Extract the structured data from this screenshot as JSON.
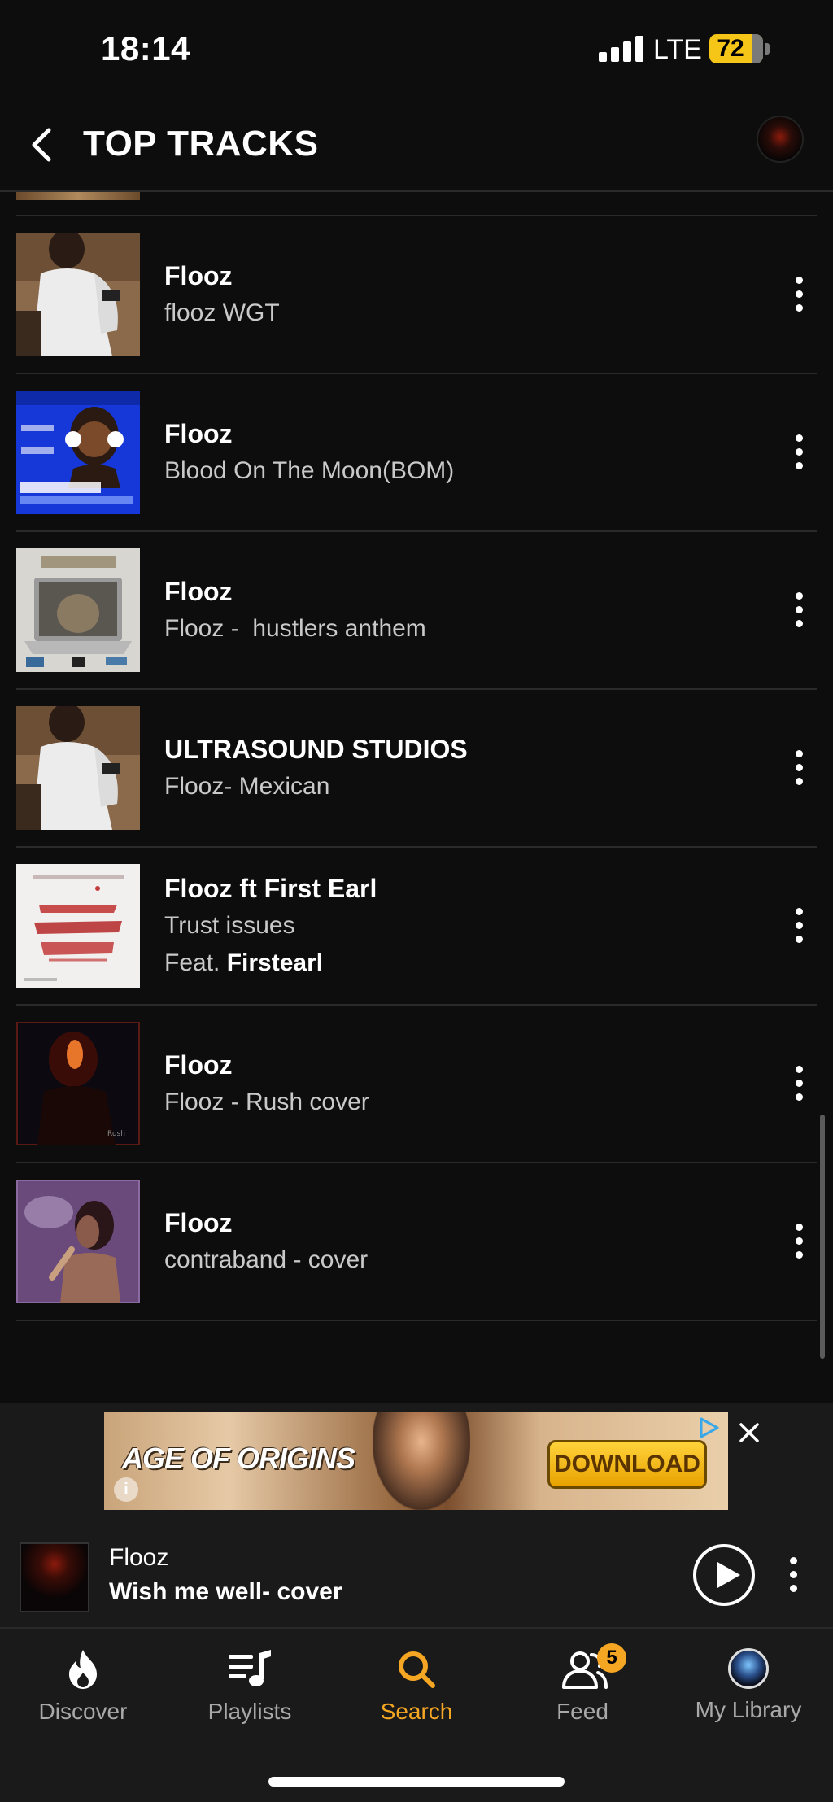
{
  "status_bar": {
    "time": "18:14",
    "network": "LTE",
    "battery": "72"
  },
  "header": {
    "title": "TOP TRACKS"
  },
  "tracks": [
    {
      "artist": "Flooz",
      "title": "flooz WGT",
      "feat_prefix": "",
      "feat_artist": "",
      "thumb": "white-hoodie-photo"
    },
    {
      "artist": "Flooz",
      "title": "Blood On The Moon(BOM)",
      "feat_prefix": "",
      "feat_artist": "",
      "thumb": "headphones-girl-cover"
    },
    {
      "artist": "Flooz",
      "title": "Flooz -  hustlers anthem",
      "feat_prefix": "",
      "feat_artist": "",
      "thumb": "laptop-cat-cover"
    },
    {
      "artist": "ULTRASOUND STUDIOS",
      "title": "Flooz- Mexican",
      "feat_prefix": "",
      "feat_artist": "",
      "thumb": "white-hoodie-photo"
    },
    {
      "artist": "Flooz ft First Earl",
      "title": "Trust issues",
      "feat_prefix": "Feat. ",
      "feat_artist": "Firstearl",
      "thumb": "trust-issues-cover"
    },
    {
      "artist": "Flooz",
      "title": "Flooz - Rush cover",
      "feat_prefix": "",
      "feat_artist": "",
      "thumb": "dark-red-portrait"
    },
    {
      "artist": "Flooz",
      "title": "contraband - cover",
      "feat_prefix": "",
      "feat_artist": "",
      "thumb": "purple-smoke-portrait"
    }
  ],
  "ad": {
    "title": "AGE OF ORIGINS",
    "button": "DOWNLOAD",
    "info": "i"
  },
  "now_playing": {
    "artist": "Flooz",
    "title": "Wish me well- cover"
  },
  "nav": {
    "items": [
      {
        "label": "Discover",
        "icon": "flame-icon"
      },
      {
        "label": "Playlists",
        "icon": "playlist-icon"
      },
      {
        "label": "Search",
        "icon": "search-icon"
      },
      {
        "label": "Feed",
        "icon": "feed-icon"
      },
      {
        "label": "My Library",
        "icon": "library-avatar"
      }
    ],
    "active": "Search",
    "feed_badge": "5"
  },
  "colors": {
    "accent": "#f5a623",
    "background": "#0d0d0d",
    "panel": "#1a1a1a",
    "battery": "#f5c518"
  }
}
